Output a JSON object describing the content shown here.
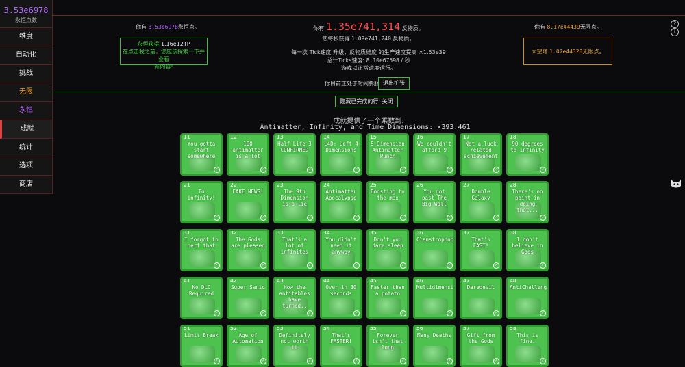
{
  "sidebar": {
    "value": "3.53e6978",
    "label": "永恒点数",
    "items": [
      {
        "label": "维度",
        "kind": "normal"
      },
      {
        "label": "自动化",
        "kind": "normal"
      },
      {
        "label": "挑战",
        "kind": "normal"
      },
      {
        "label": "无限",
        "kind": "inf"
      },
      {
        "label": "永恒",
        "kind": "eter"
      },
      {
        "label": "成就",
        "kind": "active"
      },
      {
        "label": "统计",
        "kind": "normal"
      },
      {
        "label": "选项",
        "kind": "normal"
      },
      {
        "label": "商店",
        "kind": "normal"
      }
    ]
  },
  "eternity": {
    "prefix": "你有",
    "value": "3.53e6978",
    "suffix": "永恒点。"
  },
  "eternity_box": {
    "line1_prefix": "永恒获得",
    "line1_value": "1.16e12TP",
    "line2": "在点击我之前，您应该探索一下并查看",
    "line3": "新内容!"
  },
  "antimatter": {
    "prefix": "你有",
    "value": "1.35e741,314",
    "suffix": "反物质。",
    "sub_prefix": "您每秒获得",
    "sub_value": "1.09e741,240",
    "sub_suffix": "反物质。"
  },
  "tick": {
    "line": "每一次 Tick速度 升级，反物质维度 的生产速度提高 ×1.53e39",
    "speed_prefix": "总计Ticks速度:",
    "speed_value": "8.10e67598",
    "speed_suffix": "/ 秒",
    "normal": "游戏以正常速度运行。"
  },
  "infinity": {
    "prefix": "你有",
    "value": "8.17e44439",
    "suffix": "无限点。"
  },
  "infinity_box": {
    "prefix": "大望塔",
    "value": "1.07e44320",
    "suffix": "无限点。"
  },
  "dilation": {
    "text": "你目前正处于时间膨胀",
    "exit_label": "退出扩张"
  },
  "hide_label": "隐藏已完成的行: 关闭",
  "achievements": {
    "mult_text": "成就提供了一个乘数到:",
    "mult_line": "Antimatter, Infinity, and Time Dimensions: ×393.461",
    "rows": [
      {
        "start": 11,
        "names": [
          "You gotta start somewhere",
          "100 antimatter is a lot",
          "Half Life 3 CONFIRMED",
          "L4D: Left 4 Dimensions",
          "5 Dimension Antimatter Punch",
          "We couldn't afford 9",
          "Not a luck related achievement",
          "90 degrees to infinity"
        ]
      },
      {
        "start": 21,
        "names": [
          "To infinity!",
          "FAKE NEWS!",
          "The 9th Dimension is a lie",
          "Antimatter Apocalypse",
          "Boosting to the max",
          "You got past The Big Wall",
          "Double Galaxy",
          "There's no point in doing that..."
        ]
      },
      {
        "start": 31,
        "names": [
          "I forgot to nerf that",
          "The Gods are pleased",
          "That's a lot of infinites",
          "You didn't need it anyway",
          "Don't you dare sleep",
          "Claustrophobic",
          "That's FAST!",
          "I don't believe in Gods"
        ]
      },
      {
        "start": 41,
        "names": [
          "No DLC Required",
          "Super Sanic",
          "How the antitables have turned..",
          "Over in 30 seconds",
          "Faster than a potato",
          "Multidimensional",
          "Daredevil",
          "AntiChallenged"
        ]
      },
      {
        "start": 51,
        "names": [
          "Limit Break",
          "Age of Automation",
          "Definitely not worth it",
          "That's FASTER!",
          "Forever isn't that long",
          "Many Deaths",
          "Gift from the Gods",
          "This is fine."
        ]
      }
    ]
  }
}
